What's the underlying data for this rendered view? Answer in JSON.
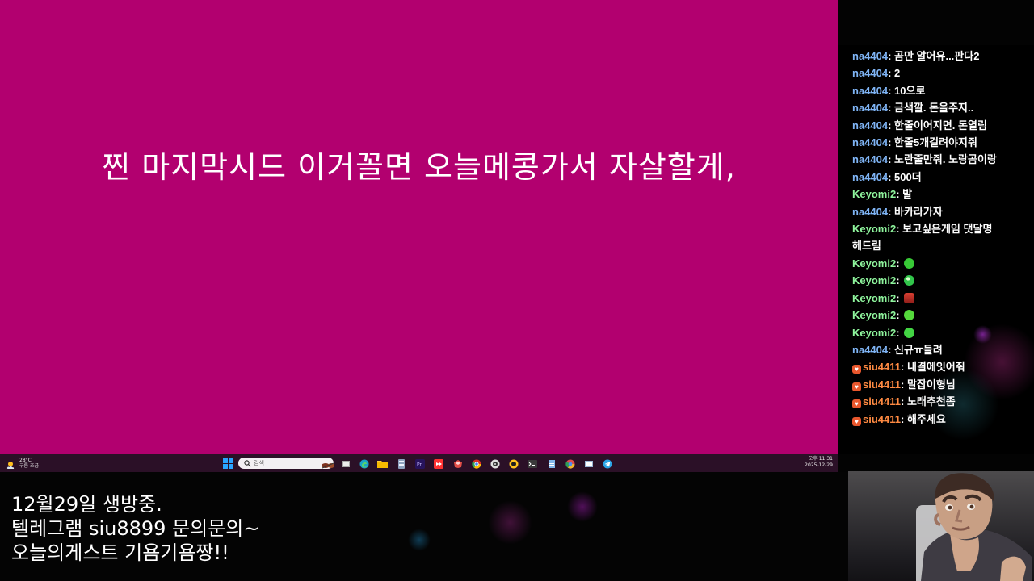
{
  "screen": {
    "message": "찐 마지막시드 이거꼴면 오늘메콩가서 자살할게,",
    "background": "#b2006f"
  },
  "taskbar": {
    "weather": {
      "temperature": "28°C",
      "condition": "구름 조금"
    },
    "search": {
      "placeholder": "검색"
    },
    "clock": {
      "time": "오후 11:31",
      "date": "2025-12-29"
    },
    "icons": [
      "windows-start-icon",
      "search-icon",
      "widgets-icon",
      "edge-icon",
      "file-explorer-icon",
      "app-icon",
      "premiere-icon",
      "streaming-app-icon",
      "game-icon",
      "chrome-icon",
      "media-icon",
      "app-icon",
      "terminal-icon",
      "notes-icon",
      "browser-icon",
      "window-icon",
      "telegram-icon"
    ]
  },
  "chat": {
    "messages": [
      {
        "user": "na4404",
        "text": "곰만 알어유...판다2",
        "color": "blue"
      },
      {
        "user": "na4404",
        "text": "2",
        "color": "blue"
      },
      {
        "user": "na4404",
        "text": "10으로",
        "color": "blue"
      },
      {
        "user": "na4404",
        "text": "금색깔. 돈을주지..",
        "color": "blue"
      },
      {
        "user": "na4404",
        "text": "한줄이어지면. 돈열림",
        "color": "blue"
      },
      {
        "user": "na4404",
        "text": "한줄5개걸려야지줘",
        "color": "blue"
      },
      {
        "user": "na4404",
        "text": "노란줄만줘. 노랑곰이랑",
        "color": "blue"
      },
      {
        "user": "na4404",
        "text": "500더",
        "color": "blue"
      },
      {
        "user": "Keyomi2",
        "text": "발",
        "color": "green"
      },
      {
        "user": "na4404",
        "text": "바카라가자",
        "color": "blue"
      },
      {
        "user": "Keyomi2",
        "text": "보고싶은게임 댓달명 헤드림",
        "color": "green"
      },
      {
        "user": "Keyomi2",
        "text": "",
        "color": "green",
        "emoji": "green-emoji-icon"
      },
      {
        "user": "Keyomi2",
        "text": "",
        "color": "green",
        "emoji": "green-thumb-emoji-icon"
      },
      {
        "user": "Keyomi2",
        "text": "",
        "color": "green",
        "emoji": "red-angry-emoji-icon"
      },
      {
        "user": "Keyomi2",
        "text": "",
        "color": "green",
        "emoji": "green-smile-emoji-icon"
      },
      {
        "user": "Keyomi2",
        "text": "",
        "color": "green",
        "emoji": "green-grin-emoji-icon"
      },
      {
        "user": "na4404",
        "text": "신규ㅠ들려",
        "color": "blue"
      },
      {
        "user": "siu4411",
        "text": "내결에잇어줘",
        "color": "orange",
        "badge": true
      },
      {
        "user": "siu4411",
        "text": "말잡이형님",
        "color": "orange",
        "badge": true
      },
      {
        "user": "siu4411",
        "text": "노래추천좀",
        "color": "orange",
        "badge": true
      },
      {
        "user": "siu4411",
        "text": "해주세요",
        "color": "orange",
        "badge": true
      }
    ]
  },
  "caption": {
    "line1": "12월29일 생방중.",
    "line2": "텔레그램 siu8899  문의문의~",
    "line3": "오늘의게스트 기욤기욤짱!!"
  }
}
